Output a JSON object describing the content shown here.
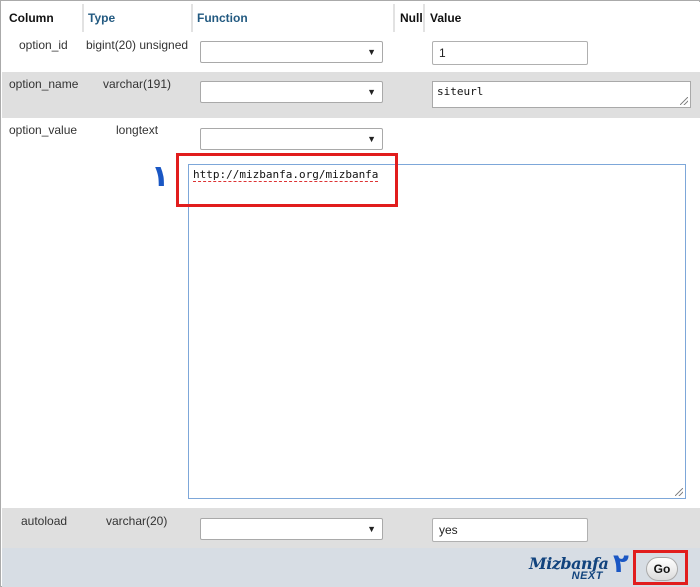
{
  "header": {
    "column": "Column",
    "type": "Type",
    "function": "Function",
    "null": "Null",
    "value": "Value"
  },
  "rows": [
    {
      "name": "option_id",
      "type": "bigint(20) unsigned",
      "value": "1"
    },
    {
      "name": "option_name",
      "type": "varchar(191)",
      "value": "siteurl"
    },
    {
      "name": "option_value",
      "type": "longtext",
      "value": "http://mizbanfa.org/mizbanfa"
    },
    {
      "name": "autoload",
      "type": "varchar(20)",
      "value": "yes"
    }
  ],
  "annotations": {
    "marker_1": "١",
    "marker_2": "٢"
  },
  "footer": {
    "logo_top": "Mizbanfa",
    "logo_bottom": "NEXT",
    "go_label": "Go"
  },
  "colors": {
    "header_link": "#235a81",
    "row_alt": "#dfdfdf",
    "footer_bg": "#d7dde4",
    "highlight_red": "#e11d1d",
    "marker_blue": "#1a57c4"
  },
  "icons": {
    "dropdown": "chevron-down-icon"
  }
}
